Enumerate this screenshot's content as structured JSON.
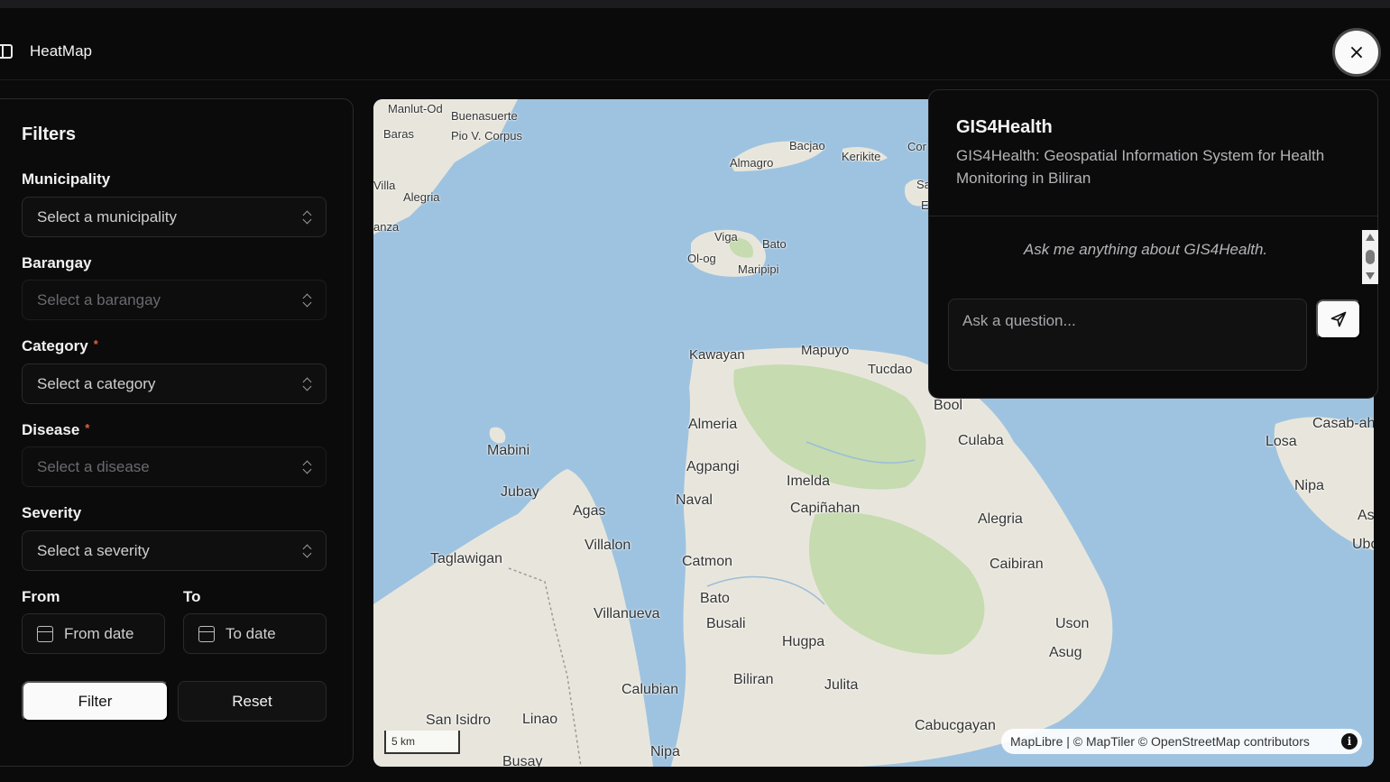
{
  "app": {
    "title": "HeatMap",
    "close_label": "×"
  },
  "filters": {
    "title": "Filters",
    "municipality": {
      "label": "Municipality",
      "placeholder": "Select a municipality"
    },
    "barangay": {
      "label": "Barangay",
      "placeholder": "Select a barangay"
    },
    "category": {
      "label": "Category",
      "required_mark": "*",
      "placeholder": "Select a category"
    },
    "disease": {
      "label": "Disease",
      "required_mark": "*",
      "placeholder": "Select a disease"
    },
    "severity": {
      "label": "Severity",
      "placeholder": "Select a severity"
    },
    "from": {
      "label": "From",
      "placeholder": "From date"
    },
    "to": {
      "label": "To",
      "placeholder": "To date"
    },
    "filter_button": "Filter",
    "reset_button": "Reset"
  },
  "map": {
    "places": {
      "manlut_od": "Manlut-Od",
      "buenasuerte": "Buenasuerte",
      "baras": "Baras",
      "pio_v_corpus": "Pio V. Corpus",
      "villa": "Villa",
      "alegria_nw": "Alegria",
      "anza": "anza",
      "bacjao": "Bacjao",
      "almagro": "Almagro",
      "kerikite": "Kerikite",
      "cor": "Cor",
      "sa": "Sa",
      "e": "E",
      "viga": "Viga",
      "bato_n": "Bato",
      "ol_og": "Ol-og",
      "maripipi": "Maripipi",
      "kawayan": "Kawayan",
      "mapuyo": "Mapuyo",
      "tucdao": "Tucdao",
      "bool": "Bool",
      "almeria": "Almeria",
      "culaba": "Culaba",
      "mabini": "Mabini",
      "agpangi": "Agpangi",
      "imelda": "Imelda",
      "naval": "Naval",
      "jubay": "Jubay",
      "capinahan": "Capiñahan",
      "agas": "Agas",
      "alegria_e": "Alegria",
      "villalon": "Villalon",
      "taglawigan": "Taglawigan",
      "catmon": "Catmon",
      "caibiran": "Caibiran",
      "bato_s": "Bato",
      "villanueva": "Villanueva",
      "busali": "Busali",
      "uson": "Uson",
      "hugpa": "Hugpa",
      "asug": "Asug",
      "biliran": "Biliran",
      "julita": "Julita",
      "calubian": "Calubian",
      "san_isidro": "San Isidro",
      "linao": "Linao",
      "cabucgayan": "Cabucgayan",
      "nipa_s": "Nipa",
      "busay": "Busay",
      "losa": "Losa",
      "casab_ah": "Casab-ah",
      "nipa_e": "Nipa",
      "as": "As",
      "ubo": "Ubo"
    },
    "scale_label": "5 km",
    "attribution": "MapLibre | © MapTiler © OpenStreetMap contributors",
    "info_icon": "i"
  },
  "chat": {
    "title": "GIS4Health",
    "description": "GIS4Health: Geospatial Information System for Health Monitoring in Biliran",
    "hint": "Ask me anything about GIS4Health.",
    "input_placeholder": "Ask a question..."
  }
}
